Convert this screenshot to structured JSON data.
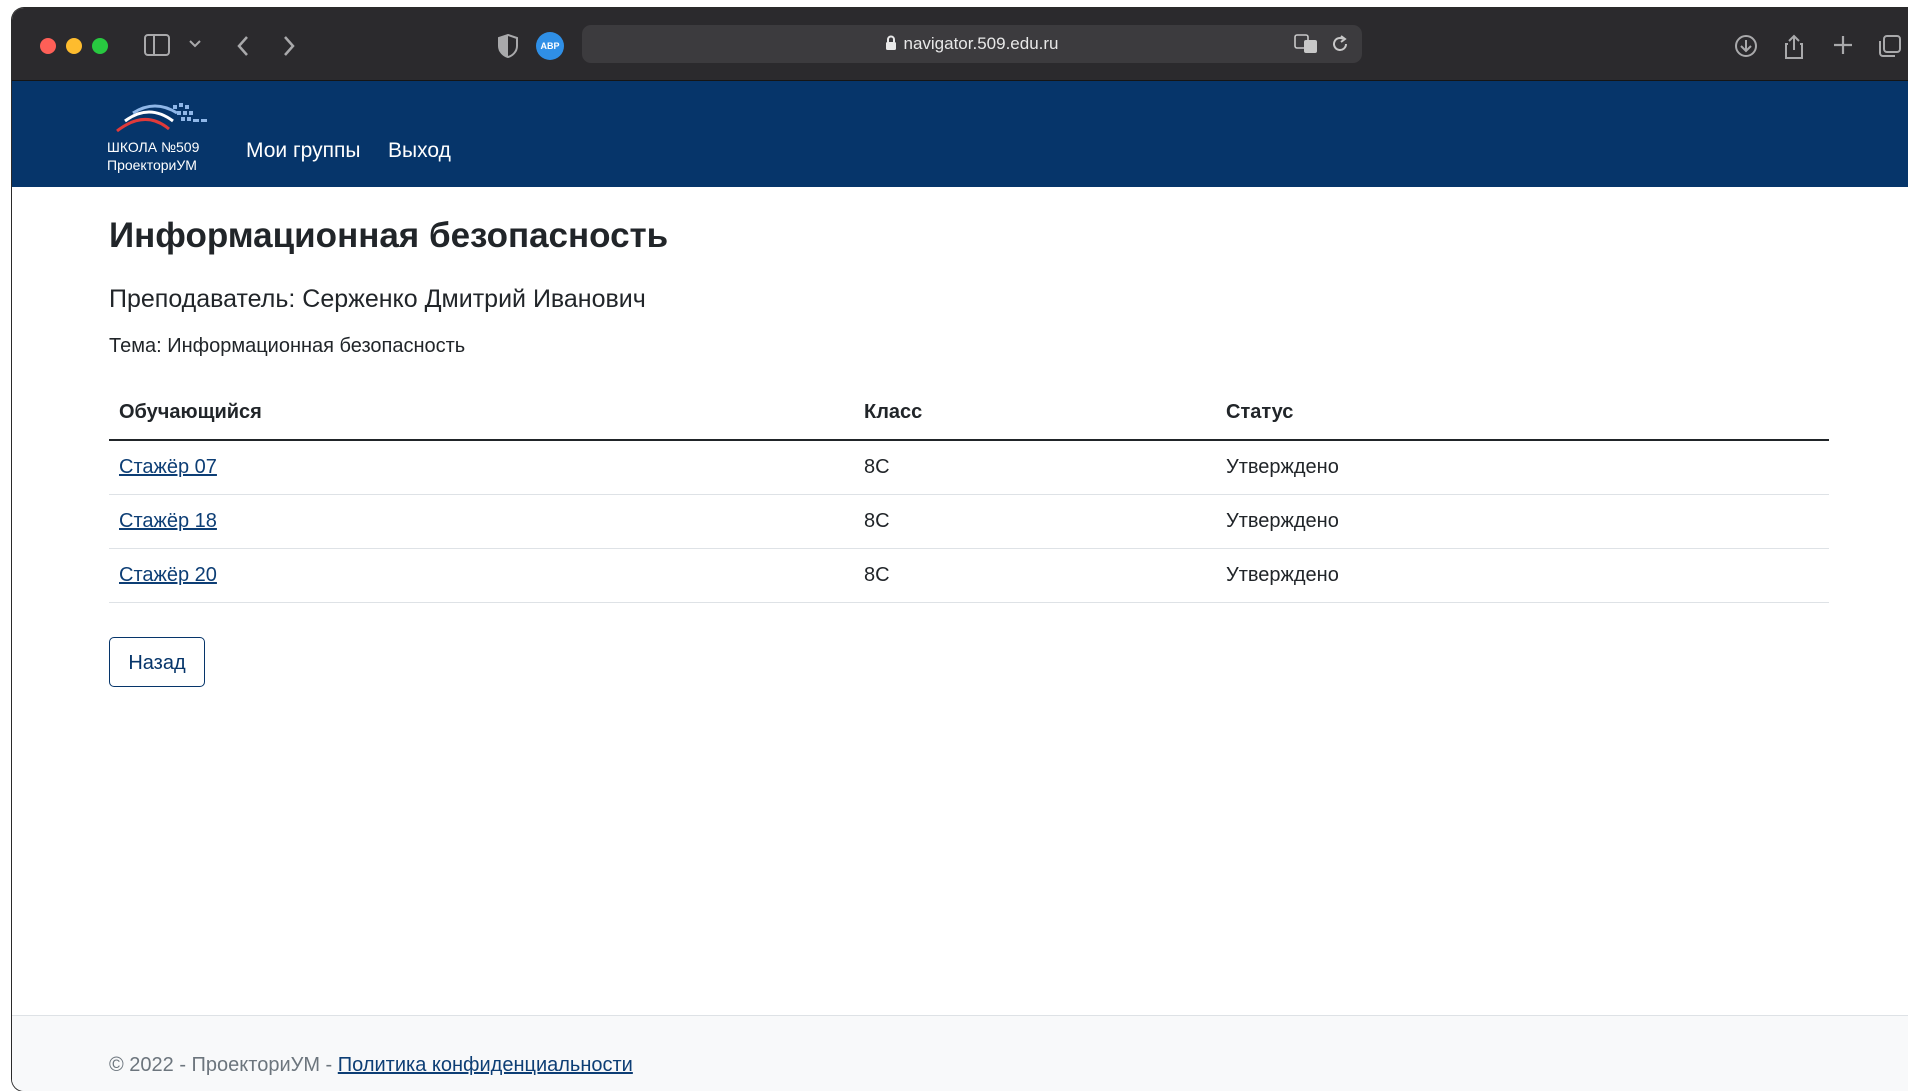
{
  "browser": {
    "url": "navigator.509.edu.ru",
    "abp_label": "ABP"
  },
  "site": {
    "logo_line1": "ШКОЛА №509",
    "logo_line2": "ПроекториУМ",
    "nav": [
      "Мои группы",
      "Выход"
    ]
  },
  "page": {
    "title": "Информационная безопасность",
    "teacher": "Преподаватель: Серженко Дмитрий Иванович",
    "topic": "Тема: Информационная безопасность",
    "table": {
      "headers": [
        "Обучающийся",
        "Класс",
        "Статус"
      ],
      "rows": [
        {
          "student": "Стажёр 07",
          "class": "8С",
          "status": "Утверждено"
        },
        {
          "student": "Стажёр 18",
          "class": "8С",
          "status": "Утверждено"
        },
        {
          "student": "Стажёр 20",
          "class": "8С",
          "status": "Утверждено"
        }
      ]
    },
    "back_button": "Назад"
  },
  "footer": {
    "copyright": "© 2022 - ПроекториУМ - ",
    "privacy_link": "Политика конфиденциальности"
  },
  "colors": {
    "navbar": "#06356a",
    "link": "#0d3e75",
    "chrome": "#2b2a2d"
  }
}
